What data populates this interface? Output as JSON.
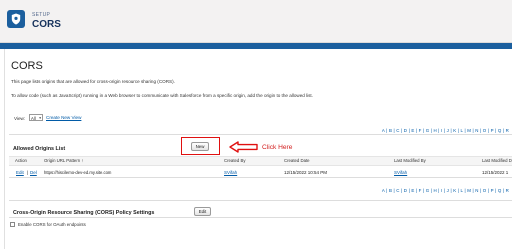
{
  "header": {
    "eyebrow": "SETUP",
    "title": "CORS"
  },
  "page": {
    "title": "CORS",
    "desc1": "This page lists origins that are allowed for cross-origin resource sharing (CORS).",
    "desc2": "To allow code (such as JavaScript) running in a Web browser to communicate with Salesforce from a specific origin, add the origin to the allowed list."
  },
  "view": {
    "label": "View:",
    "selected": "All",
    "create_link": "Create New View"
  },
  "alphabet": "A | B | C | D | E | F | G | H | I | J | K | L | M | N | O | P | Q | R",
  "allowed_origins": {
    "title": "Allowed Origins List",
    "new_button": "New",
    "annotation": "Click Here",
    "columns": [
      "Action",
      "Origin URL Pattern ↑",
      "Created By",
      "Created Date",
      "Last Modified By",
      "Last Modified D"
    ],
    "rows": [
      {
        "edit": "Edit",
        "sep": "|",
        "del": "Del",
        "origin": "https://hiscilemo-dev-ed.my.site.com",
        "created_by": "SVifah",
        "created_date": "12/15/2022 10:54 PM",
        "modified_by": "SVifah",
        "modified_date": "12/15/2022 1"
      }
    ]
  },
  "policy": {
    "title": "Cross-Origin Resource Sharing (CORS) Policy Settings",
    "edit_button": "Edit",
    "checkbox_label": "Enable CORS for OAuth endpoints"
  },
  "colors": {
    "brand": "#1b5f9e",
    "link": "#015ba7",
    "annotation": "#d21c1c"
  }
}
